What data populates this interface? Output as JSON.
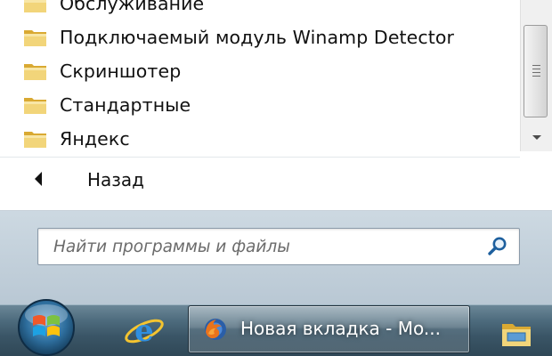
{
  "start_menu": {
    "programs": [
      {
        "label": "Обслуживание",
        "icon": "folder-icon"
      },
      {
        "label": "Подключаемый модуль Winamp Detector",
        "icon": "folder-icon"
      },
      {
        "label": "Скриншотер",
        "icon": "folder-icon"
      },
      {
        "label": "Стандартные",
        "icon": "folder-icon"
      },
      {
        "label": "Яндекс",
        "icon": "folder-icon"
      }
    ],
    "back_label": "Назад",
    "search_placeholder": "Найти программы и файлы"
  },
  "taskbar": {
    "start_icon": "windows-logo-icon",
    "pinned": [
      {
        "icon": "internet-explorer-icon"
      },
      {
        "icon": "windows-explorer-icon"
      }
    ],
    "active_window": {
      "icon": "firefox-icon",
      "label": "Новая вкладка - Mo..."
    }
  },
  "colors": {
    "menu_background": "#ffffff",
    "glass": "#c7d4de",
    "taskbar": "#3a5566",
    "folder": "#e8c15a"
  }
}
